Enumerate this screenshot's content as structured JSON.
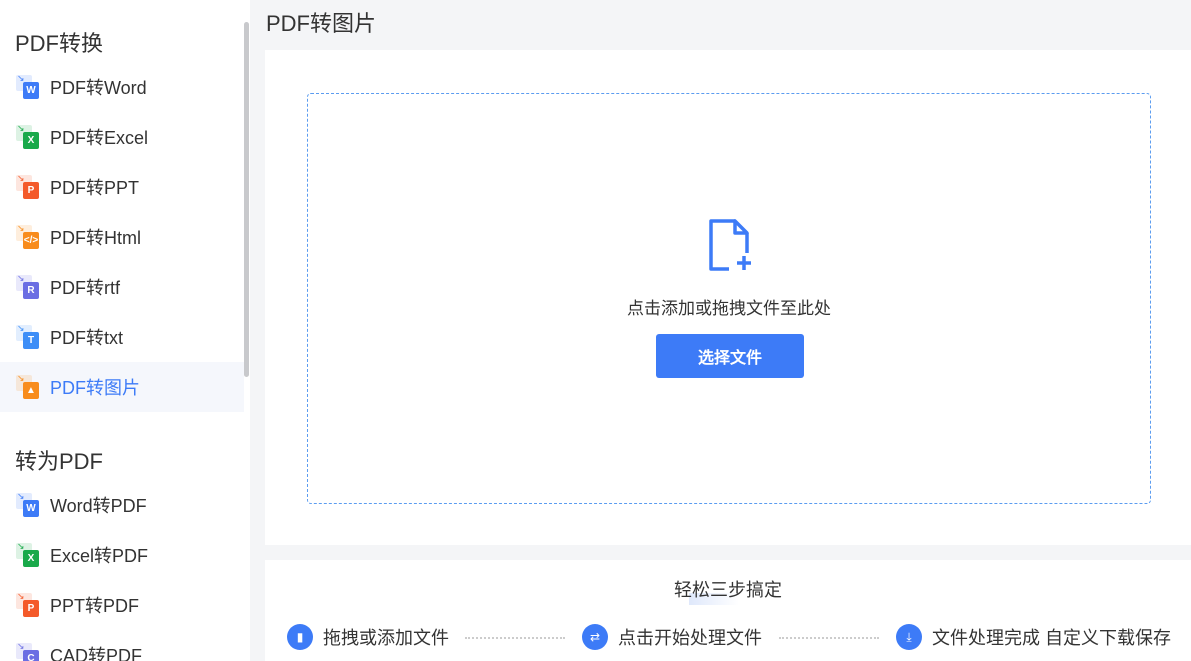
{
  "sidebar": {
    "section1": "PDF转换",
    "items1": [
      {
        "label": "PDF转Word",
        "glyph": "W",
        "color": "#3d7bf7"
      },
      {
        "label": "PDF转Excel",
        "glyph": "X",
        "color": "#19a94a"
      },
      {
        "label": "PDF转PPT",
        "glyph": "P",
        "color": "#f45a2a"
      },
      {
        "label": "PDF转Html",
        "glyph": "</>",
        "color": "#f88c1c"
      },
      {
        "label": "PDF转rtf",
        "glyph": "R",
        "color": "#6b6ee3"
      },
      {
        "label": "PDF转txt",
        "glyph": "T",
        "color": "#3d8ef7"
      },
      {
        "label": "PDF转图片",
        "glyph": "▲",
        "color": "#f88c1c"
      }
    ],
    "section2": "转为PDF",
    "items2": [
      {
        "label": "Word转PDF",
        "glyph": "W",
        "color": "#3d7bf7"
      },
      {
        "label": "Excel转PDF",
        "glyph": "X",
        "color": "#19a94a"
      },
      {
        "label": "PPT转PDF",
        "glyph": "P",
        "color": "#f45a2a"
      },
      {
        "label": "CAD转PDF",
        "glyph": "C",
        "color": "#6b6ee3"
      }
    ]
  },
  "main": {
    "title": "PDF转图片",
    "drop_hint": "点击添加或拖拽文件至此处",
    "select_button": "选择文件"
  },
  "steps": {
    "title": "轻松三步搞定",
    "items": [
      "拖拽或添加文件",
      "点击开始处理文件",
      "文件处理完成 自定义下载保存"
    ]
  }
}
